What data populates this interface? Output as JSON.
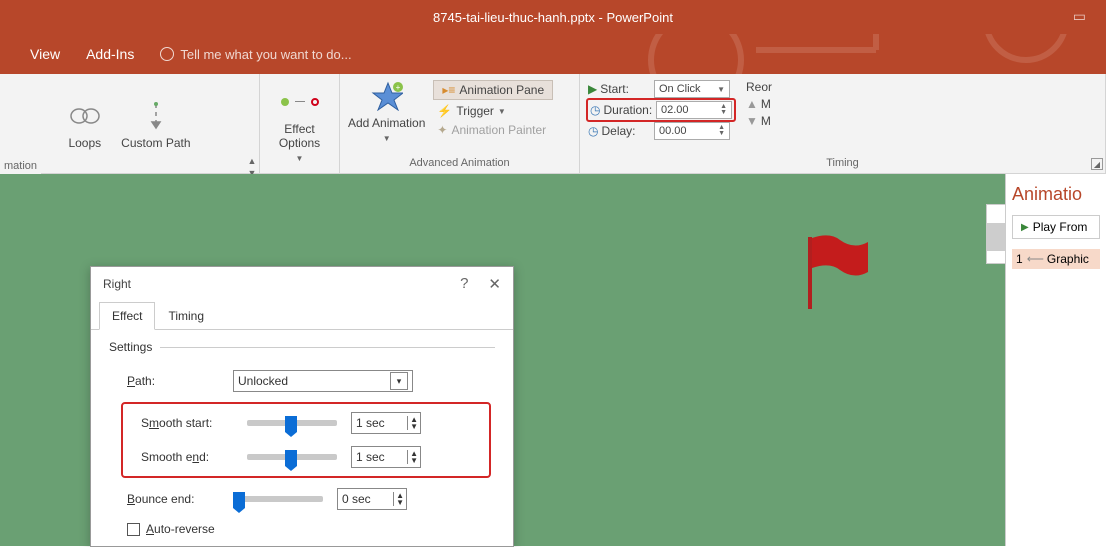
{
  "titlebar": {
    "title": "8745-tai-lieu-thuc-hanh.pptx - PowerPoint"
  },
  "menubar": {
    "view": "View",
    "addins": "Add-Ins",
    "tellme": "Tell me what you want to do..."
  },
  "ribbon": {
    "loops": "Loops",
    "custom_path": "Custom Path",
    "effect_options": "Effect Options",
    "add_animation": "Add Animation",
    "animation_pane": "Animation Pane",
    "trigger": "Trigger",
    "animation_painter": "Animation Painter",
    "advanced_label": "Advanced Animation",
    "start": "Start:",
    "start_val": "On Click",
    "duration": "Duration:",
    "duration_val": "02.00",
    "delay": "Delay:",
    "delay_val": "00.00",
    "timing_label": "Timing",
    "reorder": "Reor",
    "move_up": "M",
    "move_down": "M",
    "animation_group_label": "mation"
  },
  "anim_pane": {
    "title": "Animatio",
    "play": "Play From",
    "item1_num": "1",
    "item1": "Graphic"
  },
  "dialog": {
    "title": "Right",
    "tab_effect": "Effect",
    "tab_timing": "Timing",
    "settings": "Settings",
    "path": "Path:",
    "path_val": "Unlocked",
    "smooth_start": "Smooth start:",
    "smooth_start_val": "1 sec",
    "smooth_end": "Smooth end:",
    "smooth_end_val": "1 sec",
    "bounce_end": "Bounce end:",
    "bounce_end_val": "0 sec",
    "auto_reverse": "Auto-reverse"
  }
}
